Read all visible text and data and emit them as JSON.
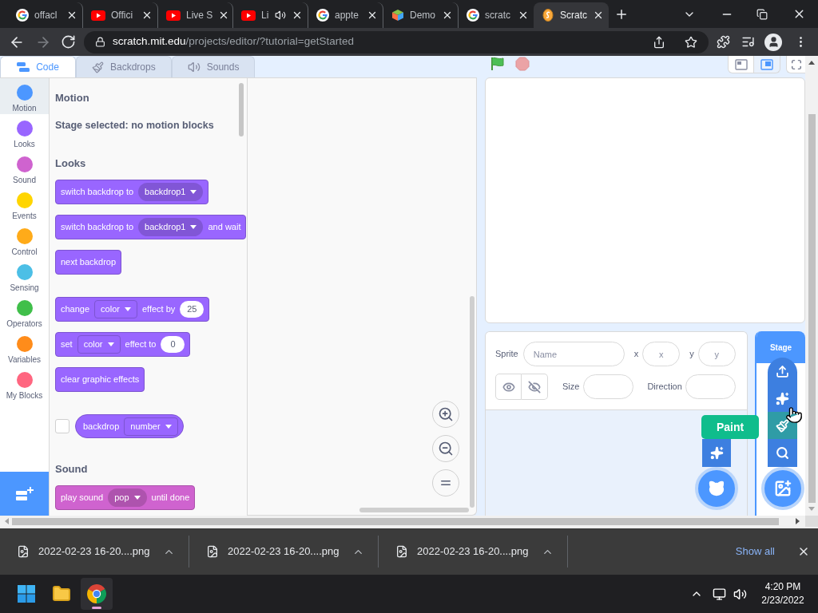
{
  "browser": {
    "tabs": [
      {
        "kind": "google",
        "title": "offacl",
        "audio": false,
        "selected": false
      },
      {
        "kind": "youtube",
        "title": "Offici",
        "audio": false,
        "selected": false
      },
      {
        "kind": "youtube",
        "title": "Live S",
        "audio": false,
        "selected": false
      },
      {
        "kind": "youtube",
        "title": "Li",
        "audio": true,
        "selected": false
      },
      {
        "kind": "google",
        "title": "appte",
        "audio": false,
        "selected": false
      },
      {
        "kind": "cube",
        "title": "Demo",
        "audio": false,
        "selected": false
      },
      {
        "kind": "google",
        "title": "scratc",
        "audio": false,
        "selected": false
      },
      {
        "kind": "scratch",
        "title": "Scratc",
        "audio": false,
        "selected": true
      }
    ],
    "address": {
      "domain": "scratch.mit.edu",
      "path": "/projects/editor/?tutorial=getStarted"
    }
  },
  "editor": {
    "tabs": [
      {
        "kind": "code",
        "label": "Code",
        "selected": true
      },
      {
        "kind": "backdrops",
        "label": "Backdrops",
        "selected": false
      },
      {
        "kind": "sounds",
        "label": "Sounds",
        "selected": false
      }
    ],
    "categories": [
      {
        "label": "Motion",
        "color": "#4c97ff",
        "selected": true
      },
      {
        "label": "Looks",
        "color": "#9966ff",
        "selected": false
      },
      {
        "label": "Sound",
        "color": "#cf63cf",
        "selected": false
      },
      {
        "label": "Events",
        "color": "#ffd500",
        "selected": false
      },
      {
        "label": "Control",
        "color": "#ffab19",
        "selected": false
      },
      {
        "label": "Sensing",
        "color": "#4cbfe6",
        "selected": false
      },
      {
        "label": "Operators",
        "color": "#40bf4a",
        "selected": false
      },
      {
        "label": "Variables",
        "color": "#ff8c1a",
        "selected": false
      },
      {
        "label": "My Blocks",
        "color": "#ff6680",
        "selected": false
      }
    ],
    "palette": [
      {
        "title": "Motion",
        "note": "Stage selected: no motion blocks"
      },
      {
        "title": "Looks",
        "color": "#9966ff",
        "groups": [
          [
            {
              "kind": "stack",
              "parts": [
                {
                  "kind": "text",
                  "text": "switch backdrop to"
                },
                {
                  "kind": "menu",
                  "text": "backdrop1"
                }
              ]
            },
            {
              "kind": "stack",
              "parts": [
                {
                  "kind": "text",
                  "text": "switch backdrop to"
                },
                {
                  "kind": "menu",
                  "text": "backdrop1"
                },
                {
                  "kind": "text",
                  "text": "and wait"
                }
              ]
            },
            {
              "kind": "stack",
              "parts": [
                {
                  "kind": "text",
                  "text": "next backdrop"
                }
              ]
            }
          ],
          [
            {
              "kind": "stack",
              "parts": [
                {
                  "kind": "text",
                  "text": "change"
                },
                {
                  "kind": "field",
                  "text": "color"
                },
                {
                  "kind": "text",
                  "text": "effect by"
                },
                {
                  "kind": "number",
                  "text": "25"
                }
              ]
            },
            {
              "kind": "stack",
              "parts": [
                {
                  "kind": "text",
                  "text": "set"
                },
                {
                  "kind": "field",
                  "text": "color"
                },
                {
                  "kind": "text",
                  "text": "effect to"
                },
                {
                  "kind": "number",
                  "text": "0"
                }
              ]
            },
            {
              "kind": "stack",
              "parts": [
                {
                  "kind": "text",
                  "text": "clear graphic effects"
                }
              ]
            }
          ],
          [
            {
              "kind": "reporter",
              "checked": false,
              "parts": [
                {
                  "kind": "text",
                  "text": "backdrop"
                },
                {
                  "kind": "field",
                  "text": "number"
                }
              ]
            }
          ]
        ]
      },
      {
        "title": "Sound",
        "color": "#cf63cf",
        "groups": [
          [
            {
              "kind": "stack",
              "parts": [
                {
                  "kind": "text",
                  "text": "play sound"
                },
                {
                  "kind": "menu",
                  "text": "pop"
                },
                {
                  "kind": "text",
                  "text": "until done"
                }
              ]
            }
          ]
        ]
      }
    ],
    "stage_modes": [
      {
        "kind": "small",
        "selected": false
      },
      {
        "kind": "large",
        "selected": true
      }
    ],
    "sprite_info": {
      "name": {
        "label": "Sprite",
        "placeholder": "Name"
      },
      "x": {
        "label": "x",
        "placeholder": "x"
      },
      "y": {
        "label": "y",
        "placeholder": "y"
      },
      "size": {
        "label": "Size"
      },
      "direction": {
        "label": "Direction"
      }
    },
    "stage_pane": {
      "title": "Stage",
      "tooltip": "Paint",
      "menu": [
        {
          "kind": "upload",
          "hovered": false
        },
        {
          "kind": "surprise",
          "hovered": false
        },
        {
          "kind": "paint",
          "hovered": true
        },
        {
          "kind": "search",
          "hovered": false
        }
      ]
    }
  },
  "downloads": {
    "items": [
      {
        "name": "2022-02-23 16-20....png"
      },
      {
        "name": "2022-02-23 16-20....png"
      },
      {
        "name": "2022-02-23 16-20....png"
      }
    ],
    "show_all": "Show all"
  },
  "taskbar": {
    "apps": [
      {
        "kind": "start",
        "selected": false
      },
      {
        "kind": "explorer",
        "selected": false
      },
      {
        "kind": "browser",
        "selected": true
      }
    ],
    "time": "4:20 PM",
    "date": "2/23/2022"
  }
}
